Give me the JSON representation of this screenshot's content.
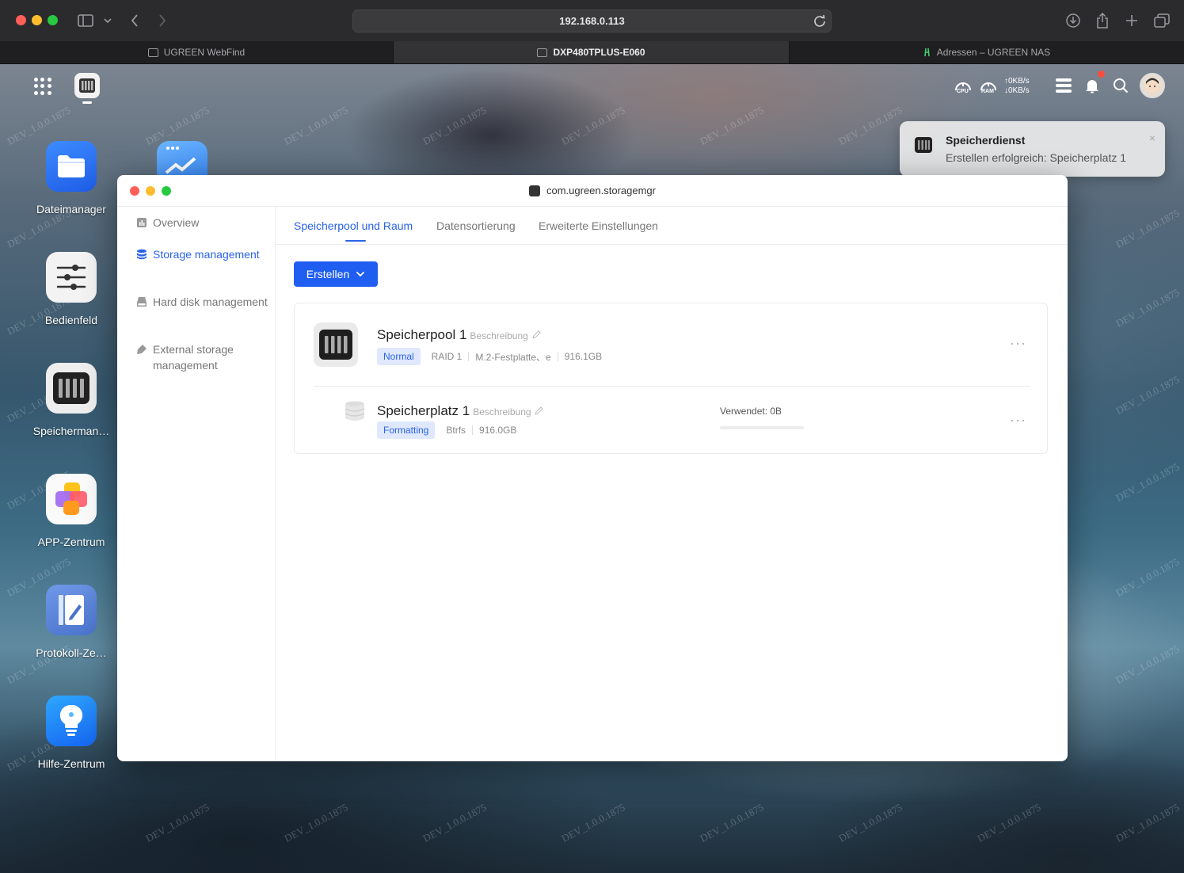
{
  "browser": {
    "url": "192.168.0.113",
    "tabs": [
      {
        "label": "UGREEN WebFind"
      },
      {
        "label": "DXP480TPLUS-E060"
      },
      {
        "label": "Adressen – UGREEN NAS"
      }
    ]
  },
  "topbar": {
    "cpu_label": "CPU",
    "ram_label": "RAM",
    "upload": "↑0KB/s",
    "download": "↓0KB/s"
  },
  "desktop": {
    "watermark": "DEV_1.0.0.1875",
    "icons": [
      {
        "label": "Dateimanager"
      },
      {
        "label": "Bedienfeld"
      },
      {
        "label": "Speicherman…"
      },
      {
        "label": "APP-Zentrum"
      },
      {
        "label": "Protokoll-Ze…"
      },
      {
        "label": "Hilfe-Zentrum"
      }
    ]
  },
  "toast": {
    "title": "Speicherdienst",
    "message": "Erstellen erfolgreich: Speicherplatz 1",
    "close": "×"
  },
  "window": {
    "title": "com.ugreen.storagemgr",
    "sidebar": [
      {
        "label": "Overview"
      },
      {
        "label": "Storage management"
      },
      {
        "label": "Hard disk management"
      },
      {
        "label": "External storage management"
      }
    ],
    "tabs": [
      {
        "label": "Speicherpool und Raum"
      },
      {
        "label": "Datensortierung"
      },
      {
        "label": "Erweiterte Einstellungen"
      }
    ],
    "create_button": "Erstellen",
    "pool": {
      "name": "Speicherpool 1",
      "description": "Beschreibung",
      "status": "Normal",
      "raid": "RAID 1",
      "disk_type": "M.2-Festplatte、e",
      "size": "916.1GB",
      "more": "···"
    },
    "volume": {
      "name": "Speicherplatz 1",
      "description": "Beschreibung",
      "status": "Formatting",
      "fs": "Btrfs",
      "size": "916.0GB",
      "used": "Verwendet: 0B",
      "used_fraction": 0,
      "more": "···"
    }
  }
}
